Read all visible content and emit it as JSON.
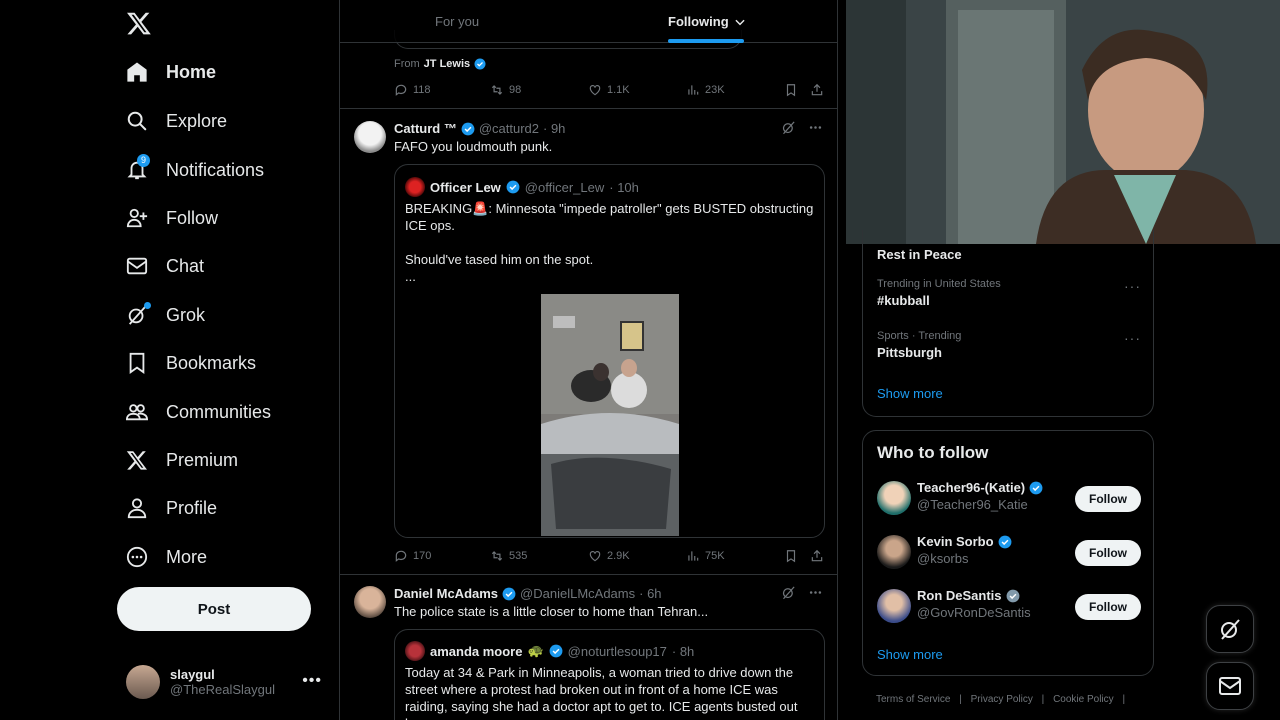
{
  "nav": {
    "items": [
      {
        "label": "Home",
        "icon": "home-icon"
      },
      {
        "label": "Explore",
        "icon": "search-icon"
      },
      {
        "label": "Notifications",
        "icon": "bell-icon",
        "badge": "9"
      },
      {
        "label": "Follow",
        "icon": "person-add-icon"
      },
      {
        "label": "Chat",
        "icon": "mail-icon"
      },
      {
        "label": "Grok",
        "icon": "grok-icon"
      },
      {
        "label": "Bookmarks",
        "icon": "bookmark-icon"
      },
      {
        "label": "Communities",
        "icon": "people-icon"
      },
      {
        "label": "Premium",
        "icon": "x-icon"
      },
      {
        "label": "Profile",
        "icon": "person-icon"
      },
      {
        "label": "More",
        "icon": "more-circle-icon"
      }
    ],
    "post_label": "Post",
    "account": {
      "name": "slaygul",
      "handle": "@TheRealSlaygul"
    }
  },
  "feed": {
    "tabs": [
      {
        "label": "For you"
      },
      {
        "label": "Following"
      }
    ],
    "prev": {
      "from_label": "From",
      "from_name": "JT Lewis",
      "replies": "118",
      "reposts": "98",
      "likes": "1.1K",
      "views": "23K"
    },
    "tweet1": {
      "name": "Catturd ™",
      "handle": "@catturd2",
      "time": "· 9h",
      "text": "FAFO you loudmouth punk.",
      "quote": {
        "name": "Officer Lew",
        "handle": "@officer_Lew",
        "time": "· 10h",
        "text": "BREAKING🚨: Minnesota \"impede patroller\" gets BUSTED obstructing ICE ops.\n\nShould've tased him on the spot.\n..."
      },
      "replies": "170",
      "reposts": "535",
      "likes": "2.9K",
      "views": "75K"
    },
    "tweet2": {
      "name": "Daniel McAdams",
      "handle": "@DanielLMcAdams",
      "time": "· 6h",
      "text": "The police state is a little closer to home than Tehran...",
      "quote": {
        "name": "amanda moore",
        "emoji": "🐢",
        "handle": "@noturtlesoup17",
        "time": "· 8h",
        "text": "Today at 34 & Park in Minneapolis, a woman tried to drive down the street where a protest had broken out in front of a home ICE was raiding, saying she had a doctor apt to get to. ICE agents busted out her"
      }
    }
  },
  "right": {
    "trends": [
      {
        "meta": "",
        "name": "Rest in Peace"
      },
      {
        "meta": "Trending in United States",
        "name": "#kubball"
      },
      {
        "meta": "Sports · Trending",
        "name": "Pittsburgh"
      }
    ],
    "trends_show_more": "Show more",
    "who_to_follow": {
      "title": "Who to follow",
      "users": [
        {
          "name": "Teacher96-(Katie)",
          "handle": "@Teacher96_Katie",
          "follow": "Follow"
        },
        {
          "name": "Kevin Sorbo",
          "handle": "@ksorbs",
          "follow": "Follow"
        },
        {
          "name": "Ron DeSantis",
          "handle": "@GovRonDeSantis",
          "follow": "Follow"
        }
      ],
      "show_more": "Show more"
    },
    "footer": [
      "Terms of Service",
      "|",
      "Privacy Policy",
      "|",
      "Cookie Policy",
      "|"
    ]
  },
  "colors": {
    "accent": "#1d9bf0",
    "background": "#000000",
    "border": "#2f3336",
    "muted": "#71767b"
  }
}
